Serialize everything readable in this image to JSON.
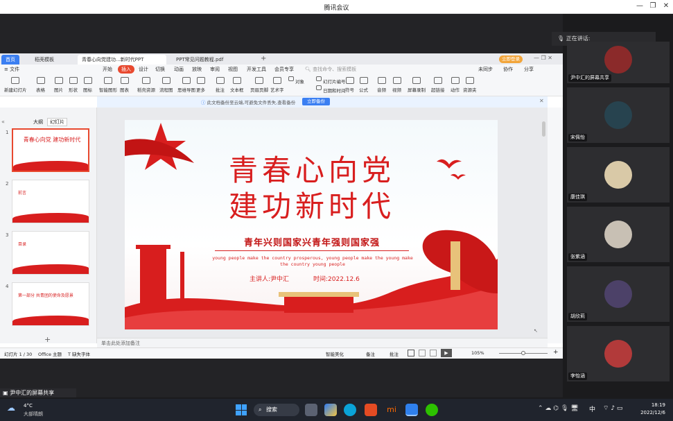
{
  "window": {
    "title": "腾讯会议"
  },
  "meeting": {
    "speaking": "正在讲话:",
    "share_label": "尹中汇的屏幕共享",
    "participants": [
      {
        "name": "尹中汇的屏幕共享"
      },
      {
        "name": "宋佩怡"
      },
      {
        "name": "康佳琪"
      },
      {
        "name": "张紫涵"
      },
      {
        "name": "胡欣莉"
      },
      {
        "name": "李怡涵"
      }
    ]
  },
  "wps": {
    "tabs": [
      "首页",
      "稻壳模板",
      "青春心向党建功...新时代PPT",
      "PPT常见问题教程.pdf"
    ],
    "login_button": "立即登录",
    "menu": [
      "文件",
      "开始",
      "插入",
      "设计",
      "切换",
      "动画",
      "放映",
      "审阅",
      "视图",
      "开发工具",
      "会员专享"
    ],
    "search_placeholder": "查找命令、搜索模板",
    "right_actions": [
      "未同步",
      "协作",
      "分享"
    ],
    "toolbar": [
      "新建幻灯片",
      "表格",
      "图片",
      "形状",
      "图标",
      "智能图形",
      "图表",
      "稻壳资源",
      "流程图",
      "思维导图",
      "更多",
      "批注",
      "文本框",
      "页眉页脚",
      "艺术字",
      "对象",
      "幻灯片编号",
      "日期和时间",
      "符号",
      "公式",
      "音频",
      "视频",
      "屏幕录制",
      "超链接",
      "动作",
      "资源夹"
    ],
    "notice_text": "此文档备份至云端,可避免文件丢失,查看备份",
    "notice_button": "立即备份",
    "panel_tabs": [
      "大纲",
      "幻灯片"
    ],
    "thumbs": [
      {
        "num": "1",
        "title": "青春心向党 建功新时代"
      },
      {
        "num": "2",
        "title": "前言"
      },
      {
        "num": "3",
        "title": "目录"
      },
      {
        "num": "4",
        "title": "第一部分 共青团的使命及愿景"
      }
    ],
    "notes_placeholder": "单击此处添加备注",
    "status": {
      "slide": "幻灯片 1 / 30",
      "theme": "Office 主题",
      "font": "缺失字体",
      "beautify": "智能美化",
      "notes": "备注",
      "comment": "批注",
      "zoom": "105%"
    }
  },
  "slide": {
    "title_line1": "青春心向党",
    "title_line2": "建功新时代",
    "subtitle": "青年兴则国家兴青年强则国家强",
    "english": "young people make the country prosperous, young people make the young make the country young people",
    "speaker": "主讲人:尹中汇",
    "time": "时间:2022.12.6"
  },
  "taskbar": {
    "weather_temp": "4°C",
    "weather_desc": "大部晴朗",
    "search": "搜索",
    "ime": "中",
    "clock_time": "18:19",
    "clock_date": "2022/12/6"
  },
  "colors": {
    "accent": "#e8492f",
    "slide_red": "#d81e1e",
    "taskbar": "#20242d"
  }
}
